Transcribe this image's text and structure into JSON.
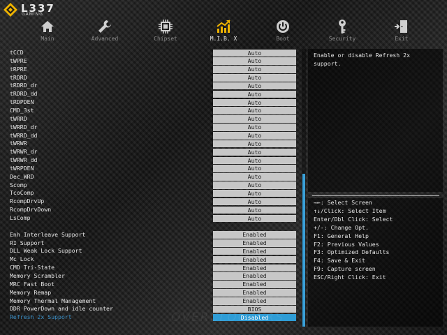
{
  "logo": {
    "brand": "L337",
    "sub": "GAMING"
  },
  "nav": [
    {
      "label": "Main",
      "icon": "home-icon"
    },
    {
      "label": "Advanced",
      "icon": "wrench-icon"
    },
    {
      "label": "Chipset",
      "icon": "chip-icon"
    },
    {
      "label": "M.I.B. X",
      "icon": "chart-icon",
      "active": true
    },
    {
      "label": "Boot",
      "icon": "power-icon"
    },
    {
      "label": "Security",
      "icon": "key-icon"
    },
    {
      "label": "Exit",
      "icon": "exit-door-icon"
    }
  ],
  "settings": [
    {
      "name": "tCCD",
      "value": "Auto"
    },
    {
      "name": "tWPRE",
      "value": "Auto"
    },
    {
      "name": "tRPRE",
      "value": "Auto"
    },
    {
      "name": "tRDRD",
      "value": "Auto"
    },
    {
      "name": "tRDRD_dr",
      "value": "Auto"
    },
    {
      "name": "tRDRD_dd",
      "value": "Auto"
    },
    {
      "name": "tRDPDEN",
      "value": "Auto"
    },
    {
      "name": "CMD_3st",
      "value": "Auto"
    },
    {
      "name": "tWRRD",
      "value": "Auto"
    },
    {
      "name": "tWRRD_dr",
      "value": "Auto"
    },
    {
      "name": "tWRRD_dd",
      "value": "Auto"
    },
    {
      "name": "tWRWR",
      "value": "Auto"
    },
    {
      "name": "tWRWR_dr",
      "value": "Auto"
    },
    {
      "name": "tWRWR_dd",
      "value": "Auto"
    },
    {
      "name": "tWRPDEN",
      "value": "Auto"
    },
    {
      "name": "Dec_WRD",
      "value": "Auto"
    },
    {
      "name": "Scomp",
      "value": "Auto"
    },
    {
      "name": "TcoComp",
      "value": "Auto"
    },
    {
      "name": "RcompDrvUp",
      "value": "Auto"
    },
    {
      "name": "RcompDrvDown",
      "value": "Auto"
    },
    {
      "name": "LsComp",
      "value": "Auto"
    },
    {
      "name": "Enh Interleave Support",
      "value": "Enabled",
      "gap": true
    },
    {
      "name": "RI Support",
      "value": "Enabled"
    },
    {
      "name": "DLL Weak Lock Support",
      "value": "Enabled"
    },
    {
      "name": "Mc Lock",
      "value": "Enabled"
    },
    {
      "name": "CMD Tri-State",
      "value": "Enabled"
    },
    {
      "name": "Memory Scrambler",
      "value": "Enabled"
    },
    {
      "name": "MRC Fast Boot",
      "value": "Enabled"
    },
    {
      "name": "Memory Remap",
      "value": "Enabled"
    },
    {
      "name": "Memory Thermal Management",
      "value": "Enabled"
    },
    {
      "name": "DDR PowerDown and idle counter",
      "value": "BIOS"
    },
    {
      "name": "Refresh 2x Support",
      "value": "Disabled",
      "selected": true
    }
  ],
  "scroll": {
    "position": 0.45,
    "visible_fraction": 0.55
  },
  "help": {
    "text": "Enable or disable Refresh 2x support."
  },
  "keys": [
    "→←: Select Screen",
    "↑↓/Click: Select Item",
    "Enter/Dbl Click: Select",
    "+/-: Change Opt.",
    "F1: General Help",
    "F2: Previous Values",
    "F3: Optimized Defaults",
    "F4: Save & Exit",
    "F9: Capture screen",
    "ESC/Right Click: Exit"
  ],
  "colors": {
    "accent": "#2f9dd6",
    "active_icon": "#f0b400",
    "value_bg": "#c7c7c7"
  }
}
